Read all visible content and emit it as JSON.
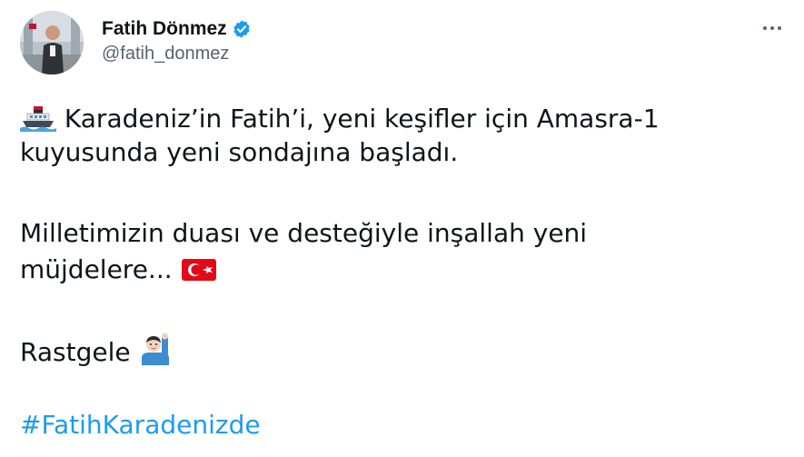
{
  "author": {
    "display_name": "Fatih Dönmez",
    "handle": "@fatih_donmez",
    "verified": true,
    "avatar_icon": "profile-photo"
  },
  "menu_icon": "more-options-icon",
  "tweet": {
    "line1_text": "Karadeniz’in Fatih’i, yeni keşifler için Amasra-1",
    "line1_emoji": "ship-icon",
    "line2_text": "kuyusunda yeni sondajına başladı.",
    "line3_text": "Milletimizin duası ve desteğiyle inşallah yeni",
    "line4_text": "müjdelere...",
    "line4_emoji": "turkey-flag-icon",
    "line5_text": "Rastgele",
    "line5_emoji": "person-raising-hand-icon",
    "hashtag": "#FatihKaradenizde"
  },
  "colors": {
    "text": "#0f1419",
    "secondary": "#536471",
    "link": "#1d9bf0",
    "verified": "#1d9bf0",
    "flag": "#e30a17"
  }
}
